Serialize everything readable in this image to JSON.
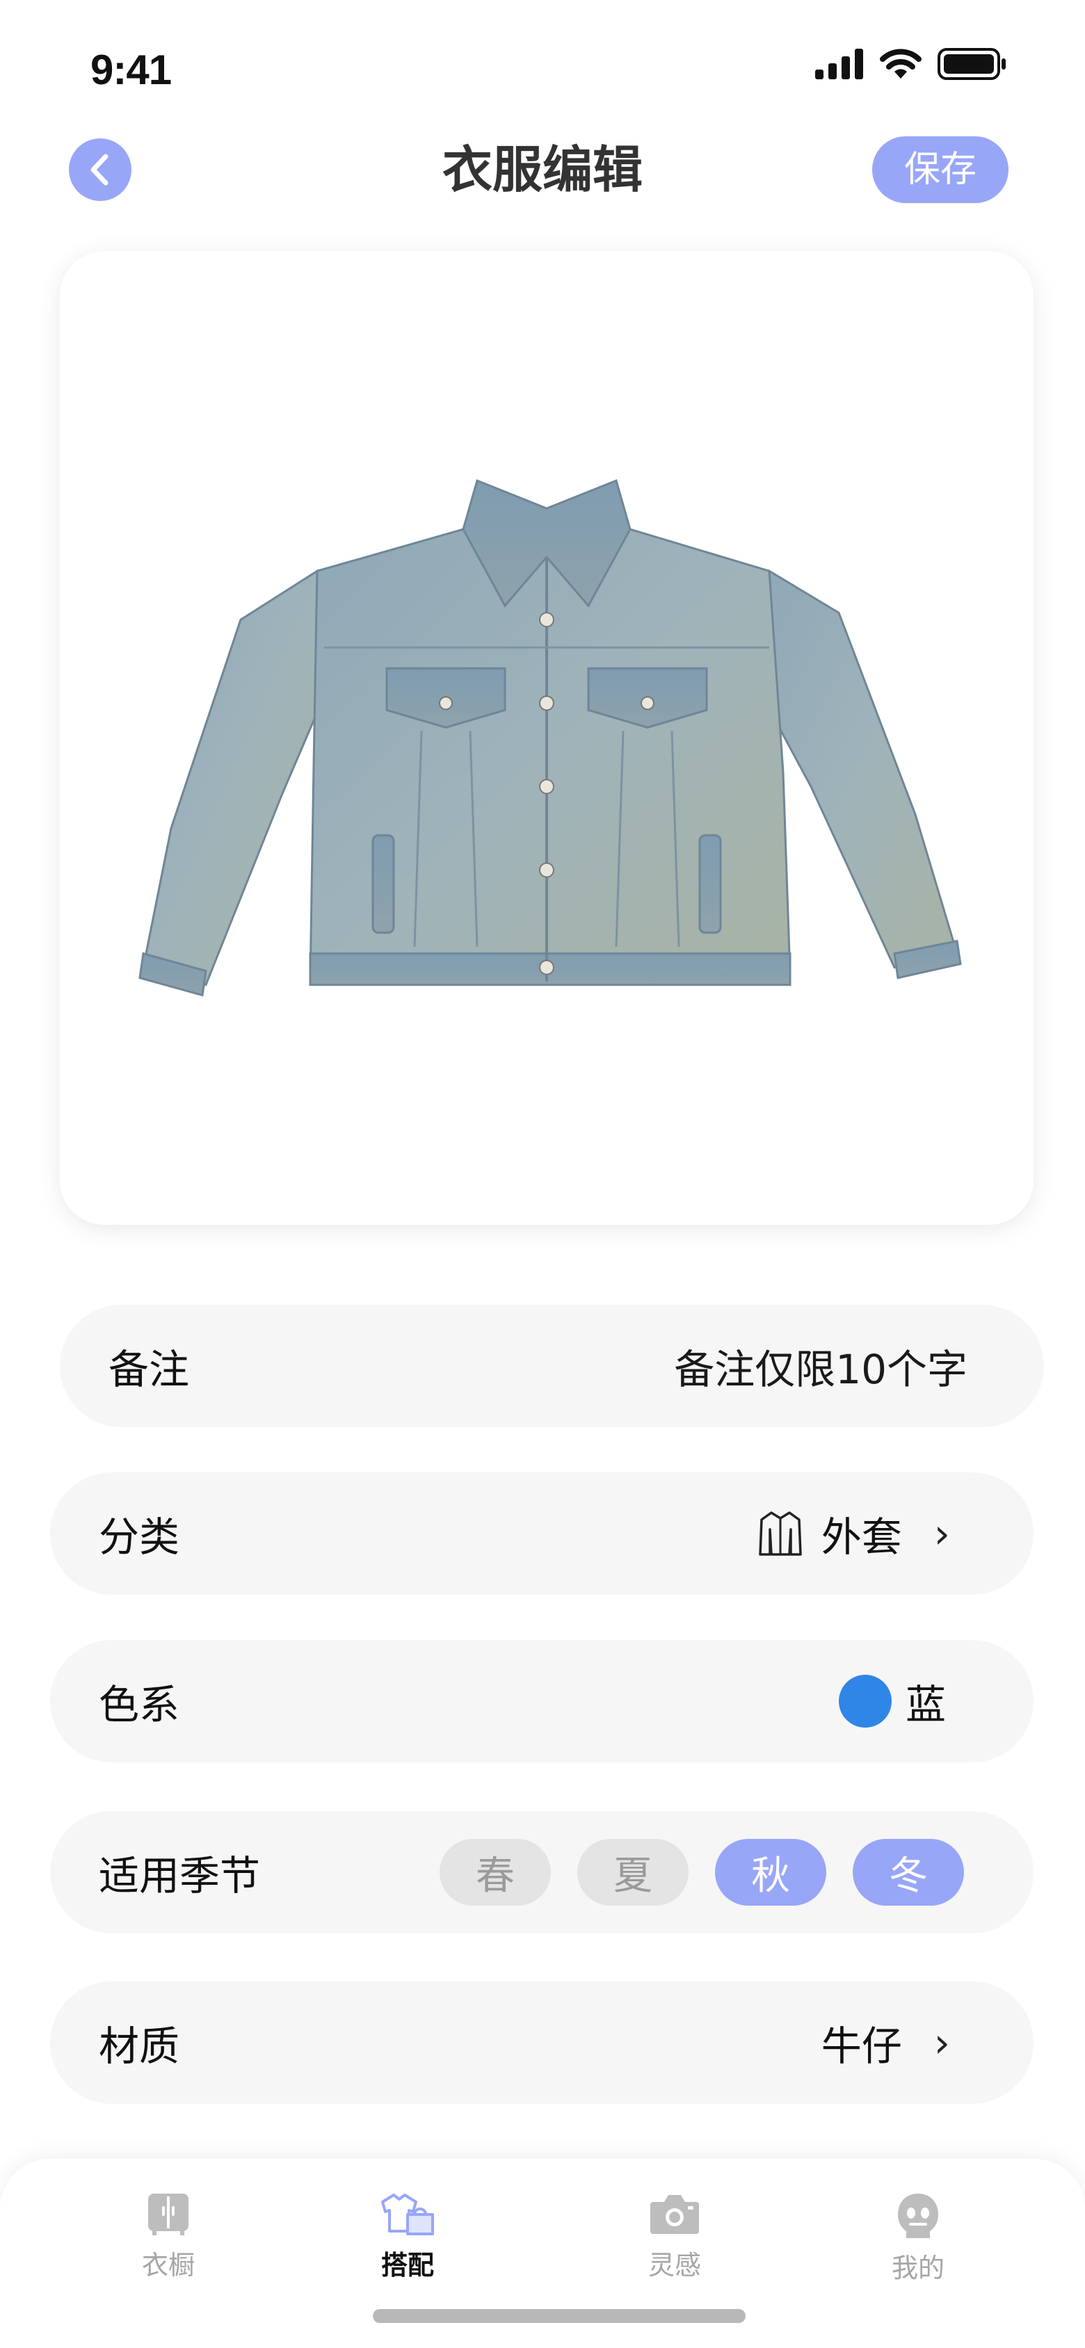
{
  "status_bar": {
    "time": "9:41"
  },
  "header": {
    "title": "衣服编辑",
    "save_label": "保存"
  },
  "item": {
    "image": "denim-jacket-image"
  },
  "fields": {
    "note": {
      "label": "备注",
      "value": "备注仅限10个字"
    },
    "category": {
      "label": "分类",
      "value": "外套",
      "icon": "jacket-icon"
    },
    "color": {
      "label": "色系",
      "value": "蓝",
      "swatch": "#2f86e6"
    },
    "season": {
      "label": "适用季节",
      "options": [
        {
          "label": "春",
          "selected": false
        },
        {
          "label": "夏",
          "selected": false
        },
        {
          "label": "秋",
          "selected": true
        },
        {
          "label": "冬",
          "selected": true
        }
      ]
    },
    "material": {
      "label": "材质",
      "value": "牛仔"
    }
  },
  "tab_bar": {
    "tabs": [
      {
        "label": "衣橱",
        "icon": "wardrobe-icon",
        "active": false
      },
      {
        "label": "搭配",
        "icon": "outfit-icon",
        "active": true
      },
      {
        "label": "灵感",
        "icon": "camera-icon",
        "active": false
      },
      {
        "label": "我的",
        "icon": "profile-icon",
        "active": false
      }
    ]
  },
  "colors": {
    "accent": "#98a6f8",
    "row_bg": "#f6f6f6",
    "inactive_chip": "#e4e4e4"
  }
}
